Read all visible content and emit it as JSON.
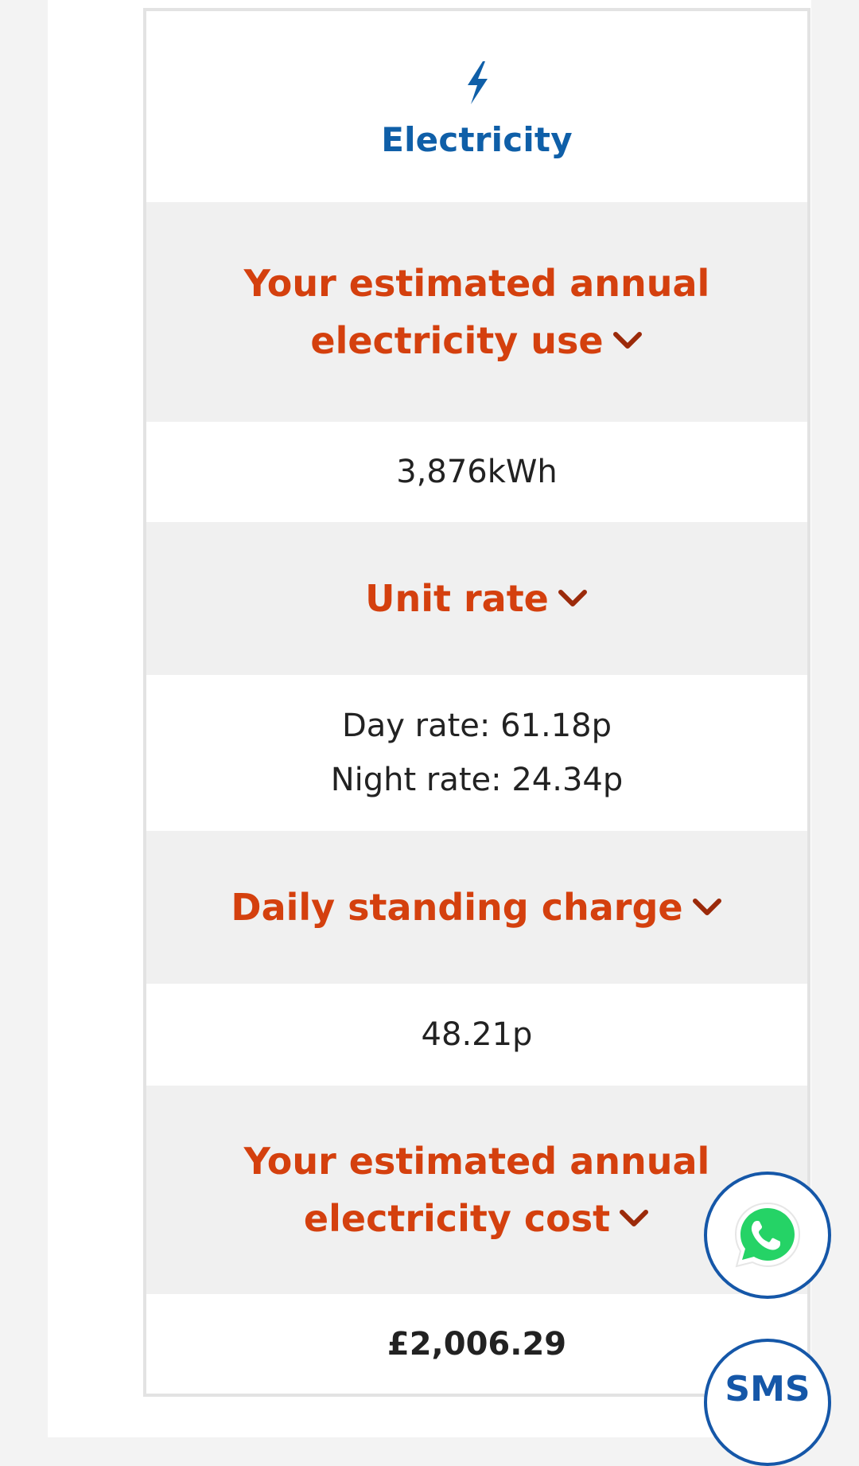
{
  "electricity": {
    "icon": "lightning-bolt-icon",
    "title": "Electricity"
  },
  "sections": {
    "annual_use": {
      "heading_line1": "Your estimated annual",
      "heading_line2": "electricity use",
      "value": "3,876kWh"
    },
    "unit_rate": {
      "heading": "Unit rate",
      "day_rate": "Day rate: 61.18p",
      "night_rate": "Night rate: 24.34p"
    },
    "standing_charge": {
      "heading": "Daily standing charge",
      "value": "48.21p"
    },
    "annual_cost": {
      "heading_line1": "Your estimated annual",
      "heading_line2": "electricity cost",
      "value": "£2,006.29"
    }
  },
  "floating_buttons": {
    "whatsapp_icon": "whatsapp-icon",
    "sms_label": "SMS"
  },
  "colors": {
    "brand_blue": "#0f5fa8",
    "heading_orange": "#d4400e",
    "chevron_red": "#9b2a0a",
    "whatsapp_green": "#25d366"
  }
}
